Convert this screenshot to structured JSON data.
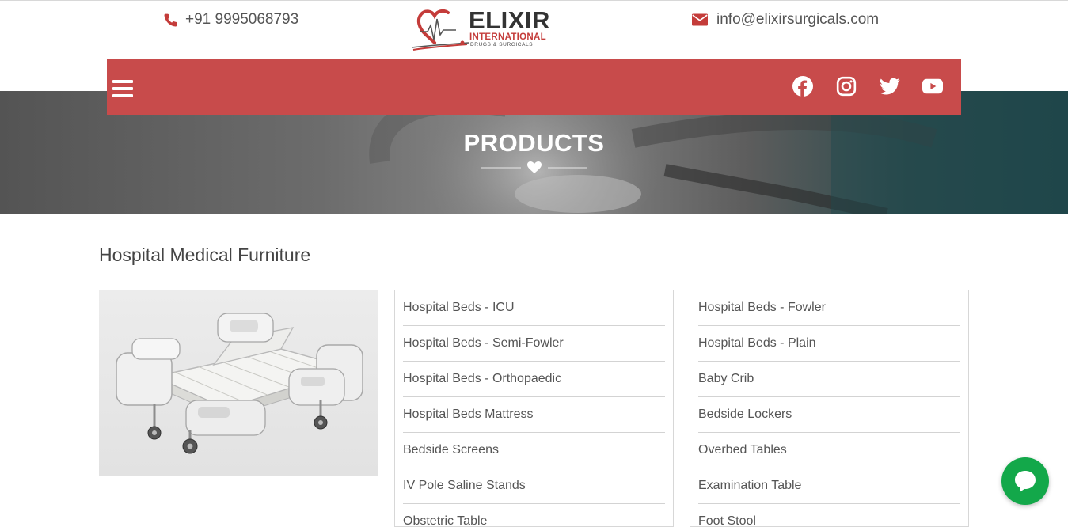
{
  "header": {
    "phone": "+91 9995068793",
    "email": "info@elixirsurgicals.com",
    "logo": {
      "brand": "ELIXIR",
      "line1": "INTERNATIONAL",
      "line2": "DRUGS & SURGICALS"
    }
  },
  "nav": {
    "menu_icon": "hamburger-menu-icon",
    "social": [
      "facebook-icon",
      "instagram-icon",
      "twitter-icon",
      "youtube-icon"
    ]
  },
  "hero": {
    "title": "PRODUCTS"
  },
  "section": {
    "title": "Hospital Medical Furniture",
    "list_a": [
      "Hospital Beds - ICU",
      "Hospital Beds - Semi-Fowler",
      "Hospital Beds - Orthopaedic",
      "Hospital Beds Mattress",
      "Bedside Screens",
      "IV Pole Saline Stands",
      "Obstetric Table"
    ],
    "list_b": [
      "Hospital Beds - Fowler",
      "Hospital Beds - Plain",
      "Baby Crib",
      "Bedside Lockers",
      "Overbed Tables",
      "Examination Table",
      "Foot Stool"
    ]
  },
  "colors": {
    "nav_red": "#c84b4b",
    "brand_red": "#c43c3a",
    "chat_green": "#13a84a"
  },
  "chat": {
    "icon": "chat-bubble-icon"
  }
}
